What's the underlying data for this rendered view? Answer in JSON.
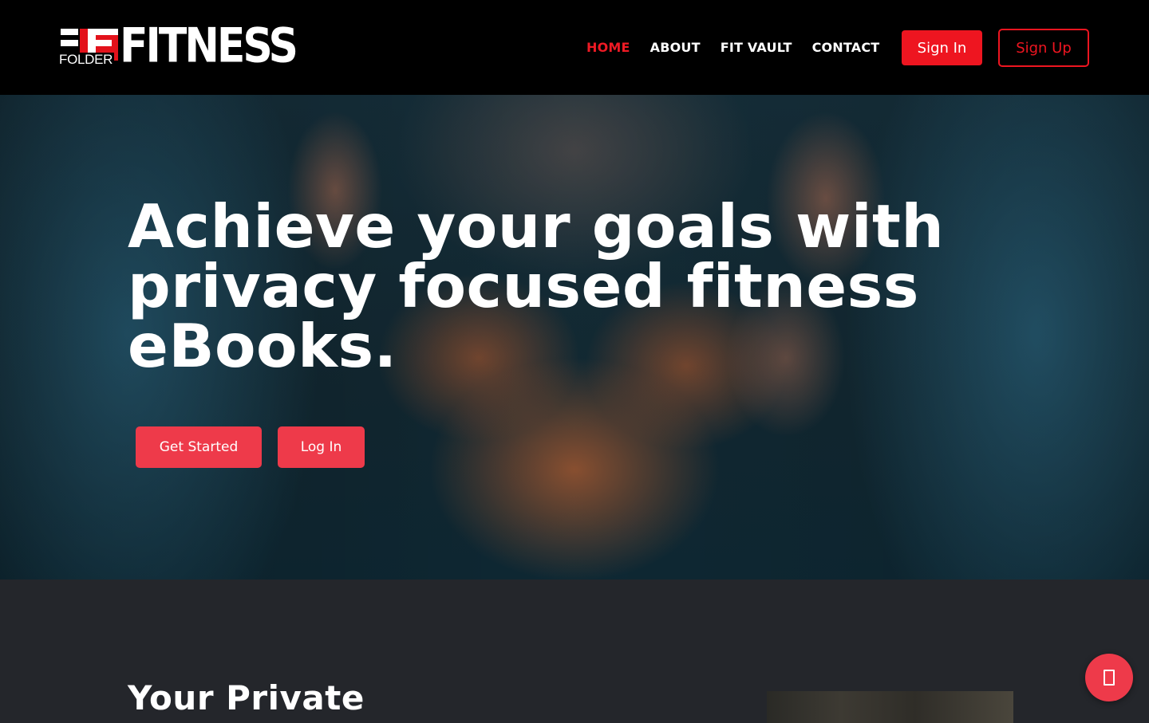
{
  "header": {
    "logo": {
      "word": "FITNESS",
      "sub": "FOLDER",
      "colors": {
        "accent": "#e3121b",
        "text": "#ffffff"
      }
    },
    "nav": [
      {
        "label": "HOME",
        "active": true
      },
      {
        "label": "ABOUT",
        "active": false
      },
      {
        "label": "FIT VAULT",
        "active": false
      },
      {
        "label": "CONTACT",
        "active": false
      }
    ],
    "sign_in_label": "Sign In",
    "sign_up_label": "Sign Up"
  },
  "hero": {
    "title": "Achieve your goals with privacy focused fitness eBooks.",
    "get_started_label": "Get Started",
    "login_label": "Log In"
  },
  "section": {
    "title": "Your Private"
  },
  "chat": {
    "icon": "chat-icon"
  },
  "colors": {
    "brand_red": "#ee1520",
    "button_red": "#ee3a4a",
    "header_bg": "#000000",
    "section_bg": "#24262b"
  }
}
